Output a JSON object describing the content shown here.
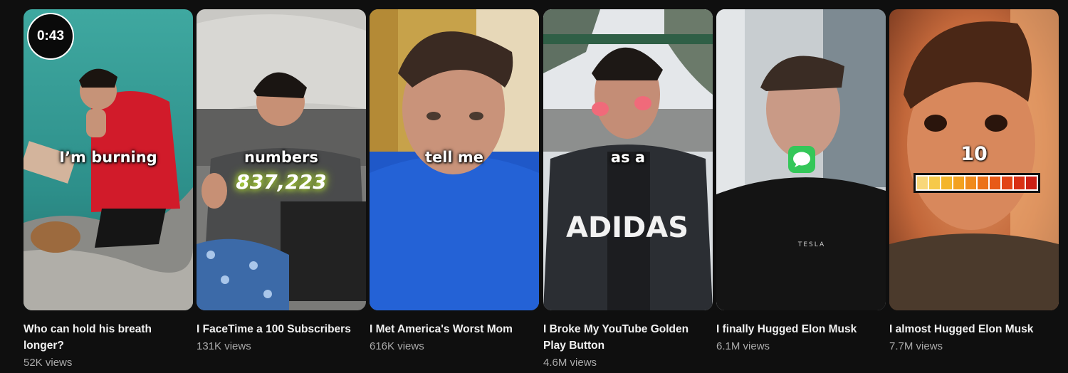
{
  "shorts": [
    {
      "title": "Who can hold his breath longer?",
      "views": "52K views",
      "duration": "0:43",
      "caption": "I’m burning"
    },
    {
      "title": "I FaceTime a 100 Subscribers",
      "views": "131K views",
      "caption": "numbers",
      "counter": "837,223"
    },
    {
      "title": "I Met America's Worst Mom",
      "views": "616K views",
      "caption": "tell me"
    },
    {
      "title": "I Broke My YouTube Golden Play Button",
      "views": "4.6M views",
      "caption": "as a",
      "shirt_text": "ADIDAS"
    },
    {
      "title": "I finally Hugged Elon Musk",
      "views": "6.1M views",
      "shirt_text": "TESLA"
    },
    {
      "title": "I almost Hugged Elon Musk",
      "views": "7.7M views",
      "level": "10",
      "level_fraction": 1.0
    }
  ],
  "colors": {
    "background": "#0f0f0f",
    "title": "#f1f1f1",
    "meta": "#aaaaaa",
    "imessage_green": "#34c759"
  },
  "icons": [
    "messages-app-icon"
  ],
  "level_segment_colors": [
    "#f8d77a",
    "#f6c94a",
    "#f4b52a",
    "#f3a11f",
    "#f08a1c",
    "#ec7219",
    "#e85a17",
    "#e24416",
    "#d93015",
    "#cc1f14"
  ]
}
